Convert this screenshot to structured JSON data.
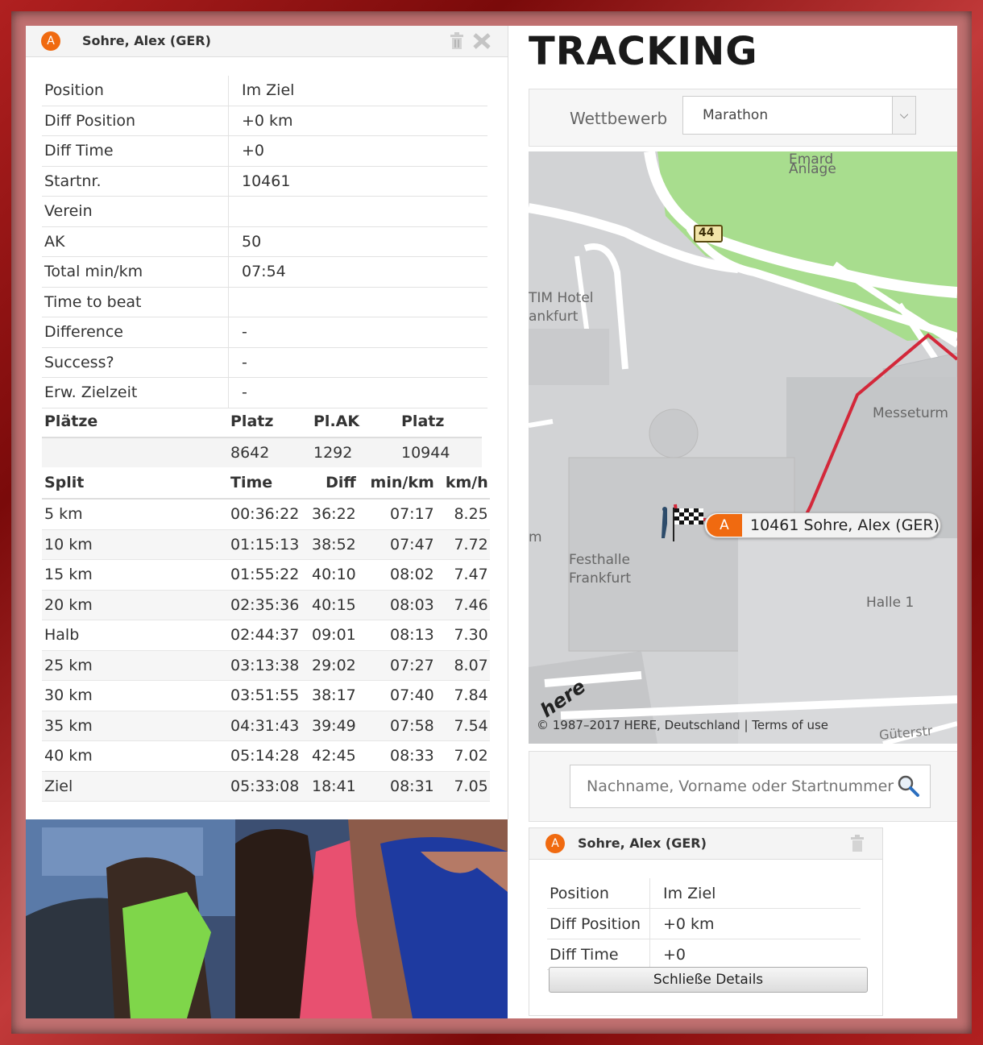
{
  "athlete_card": {
    "avatar_letter": "A",
    "name": "Sohre, Alex (GER)",
    "icons": [
      "trash-icon",
      "close-icon"
    ],
    "details": [
      {
        "label": "Position",
        "value": "Im Ziel"
      },
      {
        "label": "Diff Position",
        "value": "+0 km"
      },
      {
        "label": "Diff Time",
        "value": "+0"
      },
      {
        "label": "Startnr.",
        "value": "10461"
      },
      {
        "label": "Verein",
        "value": ""
      },
      {
        "label": "AK",
        "value": "50"
      },
      {
        "label": "Total min/km",
        "value": "07:54"
      },
      {
        "label": "Time to beat",
        "value": ""
      },
      {
        "label": "Difference",
        "value": "-"
      },
      {
        "label": "Success?",
        "value": "-"
      },
      {
        "label": "Erw. Zielzeit",
        "value": "-"
      }
    ],
    "places": {
      "headers": [
        "Plätze",
        "Platz",
        "Pl.AK",
        "Platz"
      ],
      "values": [
        "",
        "8642",
        "1292",
        "10944"
      ]
    },
    "splits": {
      "headers": [
        "Split",
        "Time",
        "Diff",
        "min/km",
        "km/h"
      ],
      "rows": [
        [
          "5 km",
          "00:36:22",
          "36:22",
          "07:17",
          "8.25"
        ],
        [
          "10 km",
          "01:15:13",
          "38:52",
          "07:47",
          "7.72"
        ],
        [
          "15 km",
          "01:55:22",
          "40:10",
          "08:02",
          "7.47"
        ],
        [
          "20 km",
          "02:35:36",
          "40:15",
          "08:03",
          "7.46"
        ],
        [
          "Halb",
          "02:44:37",
          "09:01",
          "08:13",
          "7.30"
        ],
        [
          "25 km",
          "03:13:38",
          "29:02",
          "07:27",
          "8.07"
        ],
        [
          "30 km",
          "03:51:55",
          "38:17",
          "07:40",
          "7.84"
        ],
        [
          "35 km",
          "04:31:43",
          "39:49",
          "07:58",
          "7.54"
        ],
        [
          "40 km",
          "05:14:28",
          "42:45",
          "08:33",
          "7.02"
        ],
        [
          "Ziel",
          "05:33:08",
          "18:41",
          "08:31",
          "7.05"
        ]
      ]
    }
  },
  "page": {
    "title": "TRACKING",
    "competition_label": "Wettbewerb",
    "competition_value": "Marathon"
  },
  "map": {
    "labels": {
      "park": "Anlage",
      "park_top": "Emard",
      "road": "44",
      "hotel1": "TIM Hotel",
      "hotel2": "ankfurt",
      "messeturm": "Messeturm",
      "festhalle1": "Festhalle",
      "festhalle2": "Frankfurt",
      "halle": "Halle 1",
      "left_m": "m",
      "street": "Güterstr"
    },
    "marker": {
      "letter": "A",
      "label": "10461 Sohre, Alex (GER)"
    },
    "logo": "here",
    "attribution": "© 1987–2017 HERE, Deutschland | Terms of use",
    "colors": {
      "route": "#d3283a",
      "park": "#a8dd8e",
      "marker": "#f06a10"
    }
  },
  "search": {
    "placeholder": "Nachname, Vorname oder Startnummer"
  },
  "mini_card": {
    "avatar_letter": "A",
    "name": "Sohre, Alex (GER)",
    "details": [
      {
        "label": "Position",
        "value": "Im Ziel"
      },
      {
        "label": "Diff Position",
        "value": "+0 km"
      },
      {
        "label": "Diff Time",
        "value": "+0"
      }
    ],
    "close_label": "Schließe Details"
  }
}
